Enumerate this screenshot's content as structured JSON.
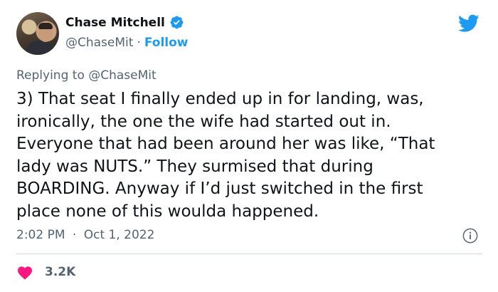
{
  "author": {
    "name": "Chase Mitchell",
    "handle": "@ChaseMit",
    "separator": "·",
    "follow_label": "Follow"
  },
  "reply": {
    "prefix": "Replying to",
    "mention": "@ChaseMit"
  },
  "tweet": {
    "text": "3) That seat I finally ended up in for landing, was,\nironically, the one the wife had started out in.\nEveryone that had been around her was like, “That\nlady was NUTS.” They surmised that during\nBOARDING. Anyway if I’d just switched in the first\nplace none of this woulda happened."
  },
  "meta": {
    "time": "2:02 PM",
    "separator": "·",
    "date": "Oct 1, 2022"
  },
  "engagement": {
    "like_count": "3.2K"
  },
  "icons": {
    "verified": "verified-badge-icon",
    "brand": "twitter-bird-icon",
    "info": "info-icon",
    "like": "heart-icon"
  },
  "colors": {
    "brand": "#1d9bf0",
    "heart": "#f91880",
    "text": "#0f1419",
    "muted": "#536471",
    "divider": "#cfd9de"
  }
}
